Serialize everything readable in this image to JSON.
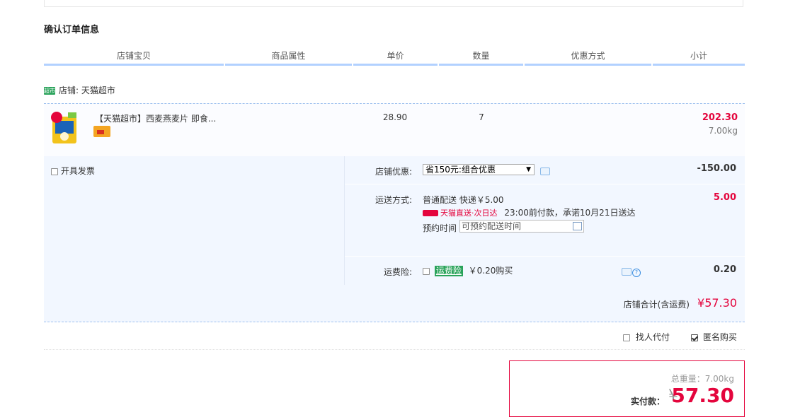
{
  "section_title": "确认订单信息",
  "columns": [
    "店铺宝贝",
    "商品属性",
    "单价",
    "数量",
    "优惠方式",
    "小计"
  ],
  "shop": {
    "icon_text": "超市",
    "label": "店铺: 天猫超市"
  },
  "item": {
    "title": "【天猫超市】西麦燕麦片 即食...",
    "price": "28.90",
    "quantity": "7",
    "subtotal": "202.30",
    "weight": "7.00kg"
  },
  "invoice_label": "开具发票",
  "discount": {
    "label": "店铺优惠:",
    "selected": "省150元:组合优惠",
    "amount": "-150.00"
  },
  "shipping": {
    "label": "运送方式:",
    "method": "普通配送 快递￥5.00",
    "tag": "天猫直送·次日达",
    "promise": "23:00前付款，承诺10月21日送达",
    "time_label": "预约时间",
    "time_placeholder": "可预约配送时间",
    "amount": "5.00"
  },
  "insurance": {
    "label": "运费险:",
    "tag": "运费险",
    "price": "￥0.20购买",
    "amount": "0.20"
  },
  "shop_total": {
    "label": "店铺合计(含运费)",
    "amount": "¥57.30"
  },
  "options": {
    "proxy_pay": "找人代付",
    "anonymous": "匿名购买"
  },
  "payment": {
    "weight": "总重量：7.00kg",
    "label": "实付款：",
    "currency": "¥",
    "amount": "57.30"
  },
  "colors": {
    "accent_red": "#e4053d",
    "header_line": "#b2d1ff",
    "green": "#2aa35b",
    "panel_bg": "#f2f7ff"
  }
}
